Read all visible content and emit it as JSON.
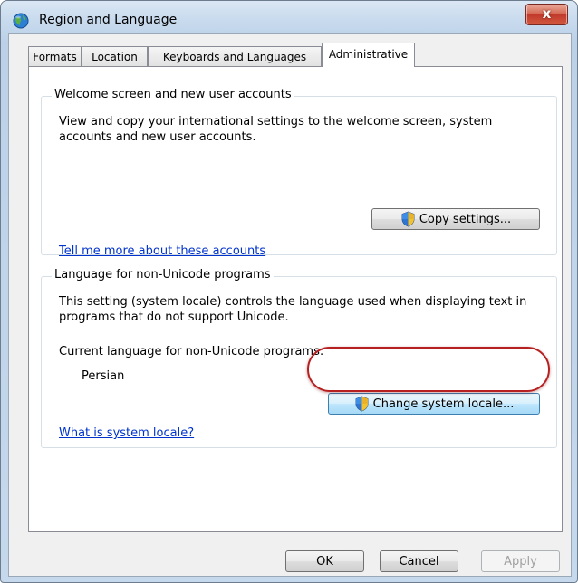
{
  "window": {
    "title": "Region and Language",
    "close_glyph": "x"
  },
  "tabs": [
    {
      "label": "Formats",
      "active": false
    },
    {
      "label": "Location",
      "active": false
    },
    {
      "label": "Keyboards and Languages",
      "active": false
    },
    {
      "label": "Administrative",
      "active": true
    }
  ],
  "welcome": {
    "title": "Welcome screen and new user accounts",
    "description": "View and copy your international settings to the welcome screen, system accounts and new user accounts.",
    "copy_button": "Copy settings...",
    "link": "Tell me more about these accounts"
  },
  "nonunicode": {
    "title": "Language for non-Unicode programs",
    "description": "This setting (system locale) controls the language used when displaying text in programs that do not support Unicode.",
    "current_label": "Current language for non-Unicode programs:",
    "current_value": "Persian",
    "change_button": "Change system locale...",
    "link": "What is system locale?"
  },
  "footer": {
    "ok": "OK",
    "cancel": "Cancel",
    "apply": "Apply"
  },
  "icons": {
    "title": "globe-icon",
    "uac": "uac-shield-icon"
  },
  "colors": {
    "link": "#0033cc",
    "highlight": "#b62020"
  }
}
